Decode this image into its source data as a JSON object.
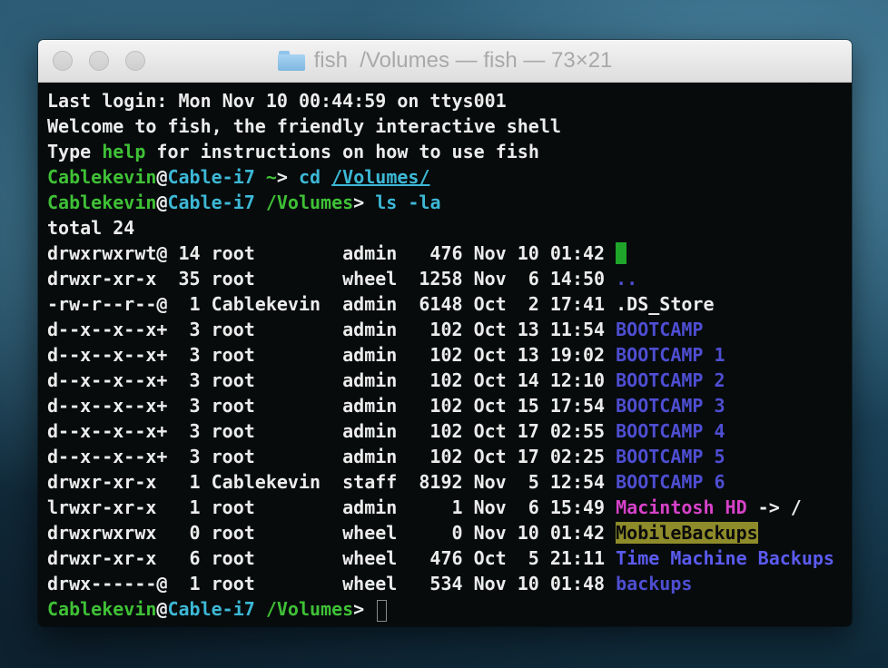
{
  "window": {
    "title": "fish  /Volumes — fish — 73×21",
    "title_icon": "folder-icon"
  },
  "colors": {
    "prompt_user": "#3fc136",
    "prompt_host": "#3db8d6",
    "directory": "#4e4ed2",
    "symlink": "#d742c9",
    "sticky_bg": "#8e8b2b",
    "dot_bg": "#1fa52a"
  },
  "intro": {
    "last_login": "Last login: Mon Nov 10 00:44:59 on ttys001",
    "welcome": "Welcome to fish, the friendly interactive shell",
    "help_pre": "Type ",
    "help_word": "help",
    "help_post": " for instructions on how to use fish"
  },
  "prompts": [
    {
      "user": "Cablekevin",
      "at": "@",
      "host": "Cable-i7",
      "cwd": " ~",
      "sym": "> ",
      "cmd": "cd ",
      "arg": "/Volumes/"
    },
    {
      "user": "Cablekevin",
      "at": "@",
      "host": "Cable-i7",
      "cwd": " /Volumes",
      "sym": "> ",
      "cmd": "ls -la",
      "arg": ""
    },
    {
      "user": "Cablekevin",
      "at": "@",
      "host": "Cable-i7",
      "cwd": " /Volumes",
      "sym": "> ",
      "cmd": "",
      "arg": ""
    }
  ],
  "listing": {
    "total": "total 24",
    "rows": [
      {
        "meta": "drwxrwxrwt@ 14 root        admin   476 Nov 10 01:42 ",
        "name": ".",
        "suffix": ""
      },
      {
        "meta": "drwxr-xr-x  35 root        wheel  1258 Nov  6 14:50 ",
        "name": "..",
        "suffix": ""
      },
      {
        "meta": "-rw-r--r--@  1 Cablekevin  admin  6148 Oct  2 17:41 ",
        "name": ".DS_Store",
        "suffix": ""
      },
      {
        "meta": "d--x--x--x+  3 root        admin   102 Oct 13 11:54 ",
        "name": "BOOTCAMP",
        "suffix": ""
      },
      {
        "meta": "d--x--x--x+  3 root        admin   102 Oct 13 19:02 ",
        "name": "BOOTCAMP 1",
        "suffix": ""
      },
      {
        "meta": "d--x--x--x+  3 root        admin   102 Oct 14 12:10 ",
        "name": "BOOTCAMP 2",
        "suffix": ""
      },
      {
        "meta": "d--x--x--x+  3 root        admin   102 Oct 15 17:54 ",
        "name": "BOOTCAMP 3",
        "suffix": ""
      },
      {
        "meta": "d--x--x--x+  3 root        admin   102 Oct 17 02:55 ",
        "name": "BOOTCAMP 4",
        "suffix": ""
      },
      {
        "meta": "d--x--x--x+  3 root        admin   102 Oct 17 02:25 ",
        "name": "BOOTCAMP 5",
        "suffix": ""
      },
      {
        "meta": "drwxr-xr-x   1 Cablekevin  staff  8192 Nov  5 12:54 ",
        "name": "BOOTCAMP 6",
        "suffix": ""
      },
      {
        "meta": "lrwxr-xr-x   1 root        admin     1 Nov  6 15:49 ",
        "name": "Macintosh HD",
        "suffix": " -> /"
      },
      {
        "meta": "drwxrwxrwx   0 root        wheel     0 Nov 10 01:42 ",
        "name": "MobileBackups",
        "suffix": ""
      },
      {
        "meta": "drwxr-xr-x   6 root        wheel   476 Oct  5 21:11 ",
        "name": "Time Machine Backups",
        "suffix": ""
      },
      {
        "meta": "drwx------@  1 root        wheel   534 Nov 10 01:48 ",
        "name": "backups",
        "suffix": ""
      }
    ]
  }
}
